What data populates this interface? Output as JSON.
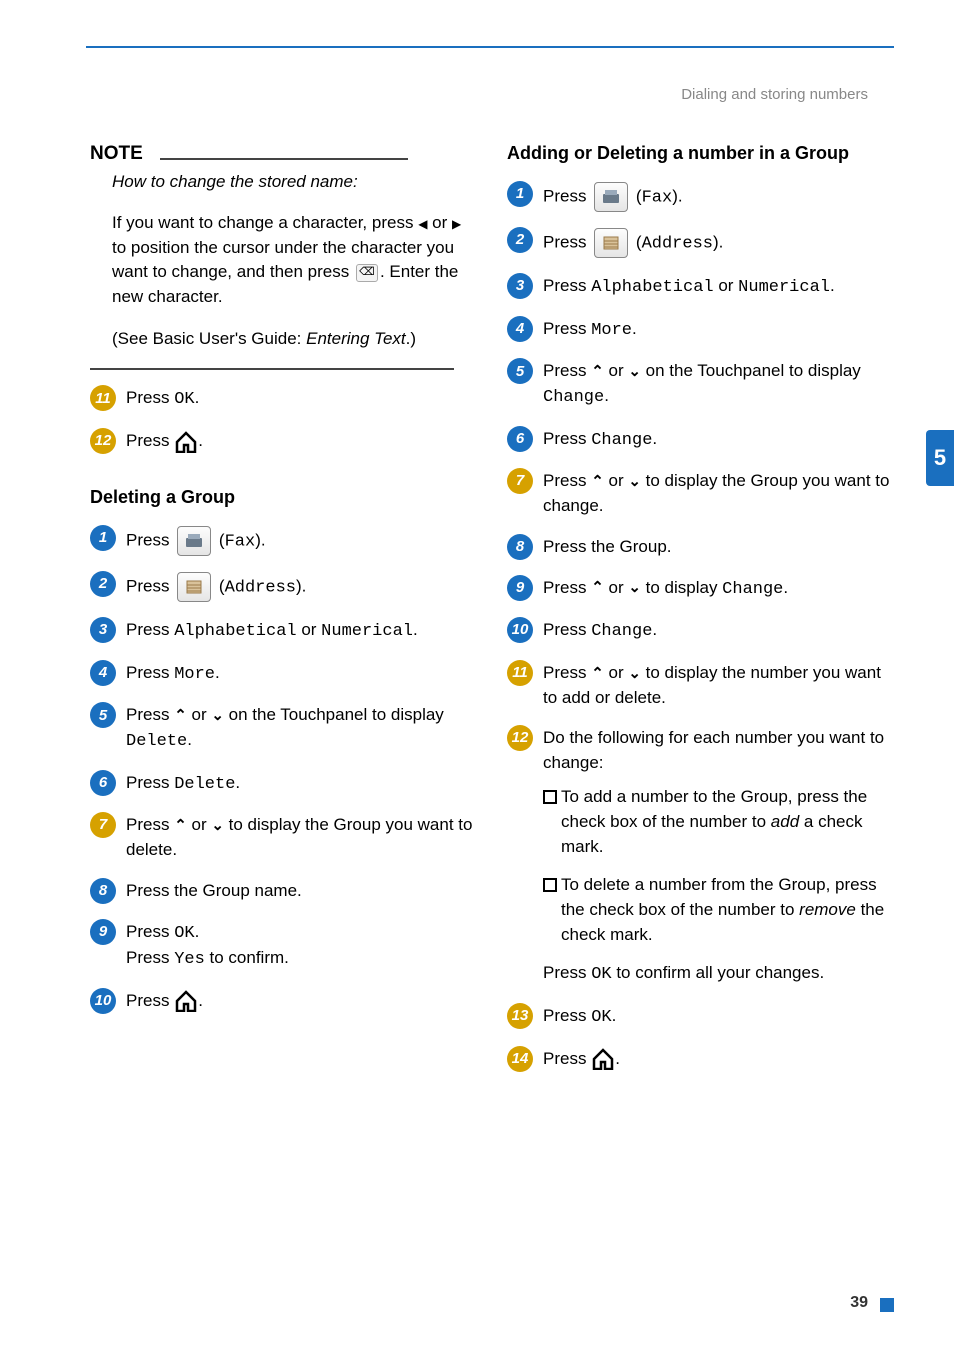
{
  "header": {
    "section": "Dialing and storing numbers"
  },
  "page_number": "39",
  "tab_label": "5",
  "col1": {
    "note": {
      "label": "NOTE",
      "intro": "How to change the stored name:",
      "body_pre": "If you want to change a character, press ",
      "body_mid": " to position the cursor under the character you want to change, and then press ",
      "body_post": ". Enter the new character.",
      "see_pre": "(See Basic User's Guide: ",
      "see_link": "Entering Text",
      "see_post": ".)"
    },
    "step11": {
      "press": "Press ",
      "ok": "OK",
      "end": "."
    },
    "step12": {
      "press": "Press ",
      "end": "."
    },
    "heading_delete": "Deleting a Group",
    "d1": {
      "press": "Press ",
      "fax": "Fax",
      "end": ")."
    },
    "d2": {
      "press": "Press ",
      "addr": "Address",
      "end": ")."
    },
    "d3": {
      "press": "Press ",
      "a": "Alphabetical",
      "or": " or ",
      "b": "Numerical",
      "end": "."
    },
    "d4": {
      "press": "Press ",
      "more": "More",
      "end": "."
    },
    "d5": {
      "pre": "Press ",
      "mid1": " or ",
      "mid2": " on the Touchpanel to display ",
      "del": "Delete",
      "end": "."
    },
    "d6": {
      "press": "Press ",
      "del": "Delete",
      "end": "."
    },
    "d7": {
      "pre": "Press ",
      "mid": " or ",
      "post": " to display the Group you want to delete."
    },
    "d8": {
      "text": "Press the Group name."
    },
    "d9": {
      "l1a": "Press ",
      "ok": "OK",
      "l1b": ".",
      "l2a": "Press ",
      "yes": "Yes",
      "l2b": " to confirm."
    },
    "d10": {
      "press": "Press ",
      "end": "."
    }
  },
  "col2": {
    "heading": "Adding or Deleting a number in a Group",
    "g1": {
      "press": "Press ",
      "fax": "Fax",
      "end": ")."
    },
    "g2": {
      "press": "Press ",
      "addr": "Address",
      "end": ")."
    },
    "g3": {
      "press": "Press ",
      "a": "Alphabetical",
      "or": " or ",
      "b": "Numerical",
      "end": "."
    },
    "g4": {
      "press": "Press ",
      "more": "More",
      "end": "."
    },
    "g5": {
      "pre": "Press ",
      "mid1": " or ",
      "mid2": " on the Touchpanel to display ",
      "chg": "Change",
      "end": "."
    },
    "g6": {
      "press": "Press ",
      "chg": "Change",
      "end": "."
    },
    "g7": {
      "pre": "Press ",
      "mid": " or ",
      "post": " to display the Group you want to change."
    },
    "g8": {
      "text": "Press the Group."
    },
    "g9": {
      "pre": "Press ",
      "mid": " or ",
      "post": " to display ",
      "chg": "Change",
      "end": "."
    },
    "g10": {
      "press": "Press ",
      "chg": "Change",
      "end": "."
    },
    "g11": {
      "pre": "Press ",
      "mid": " or ",
      "post": " to display the number you want to add or delete."
    },
    "g12": {
      "intro": "Do the following for each number you want to change:",
      "b1_pre": "To add a number to the Group, press the check box of the number to ",
      "b1_em": "add",
      "b1_post": " a check mark.",
      "b2_pre": "To delete a number from the Group, press the check box of the number to ",
      "b2_em": "remove",
      "b2_post": " the check mark.",
      "final_pre": "Press ",
      "ok": "OK",
      "final_post": " to confirm all your changes."
    },
    "g13": {
      "press": "Press ",
      "ok": "OK",
      "end": "."
    },
    "g14": {
      "press": "Press ",
      "end": "."
    }
  }
}
